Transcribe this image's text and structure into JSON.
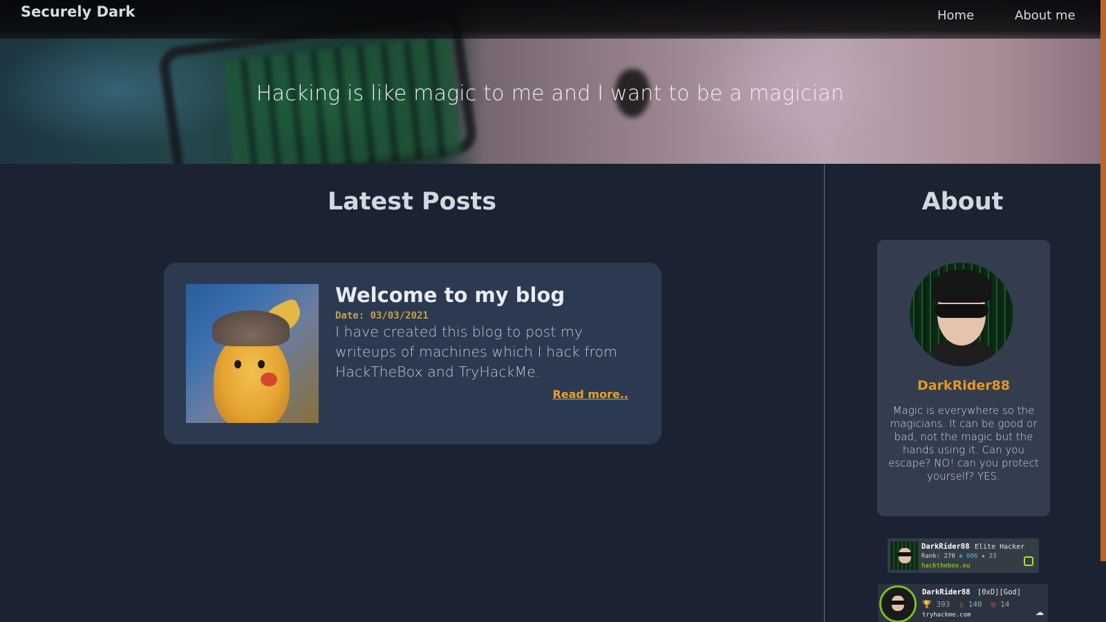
{
  "nav": {
    "brand": "Securely Dark",
    "links": [
      "Home",
      "About me"
    ]
  },
  "hero": {
    "tagline": "Hacking is like magic to me and I want to be a magician"
  },
  "main": {
    "posts_title": "Latest Posts",
    "posts": [
      {
        "title": "Welcome to my blog",
        "date": "Date: 03/03/2021",
        "excerpt": "I have created this blog to post my writeups of machines which I hack from HackTheBox and TryHackMe.",
        "read_more": "Read more.."
      }
    ]
  },
  "about": {
    "title": "About",
    "name": "DarkRider88",
    "bio": "Magic is everywhere so the magicians. It can be good or bad, not the magic but the hands using it. Can you escape? NO! can you protect yourself? YES."
  },
  "badges": {
    "htb": {
      "username": "DarkRider88",
      "rank_name": "Elite Hacker",
      "rank_label": "Rank: 270",
      "respect_icon": "✥",
      "respect": "606",
      "star_icon": "★",
      "stars": "23",
      "site": "hackthebox.eu"
    },
    "thm": {
      "username": "DarkRider88",
      "tag": "[0xD][God]",
      "trophy_icon": "🏆",
      "points": "393",
      "door_icon": "▯",
      "rooms": "140",
      "target_icon": "◎",
      "badges": "14",
      "site": "tryhackme.com",
      "cloud_icon": "☁"
    }
  },
  "colors": {
    "background": "#1b2333",
    "card": "#2c3a51",
    "accent_orange": "#e8961f",
    "date_gold": "#c9a046",
    "htb_green": "#9fef00"
  }
}
